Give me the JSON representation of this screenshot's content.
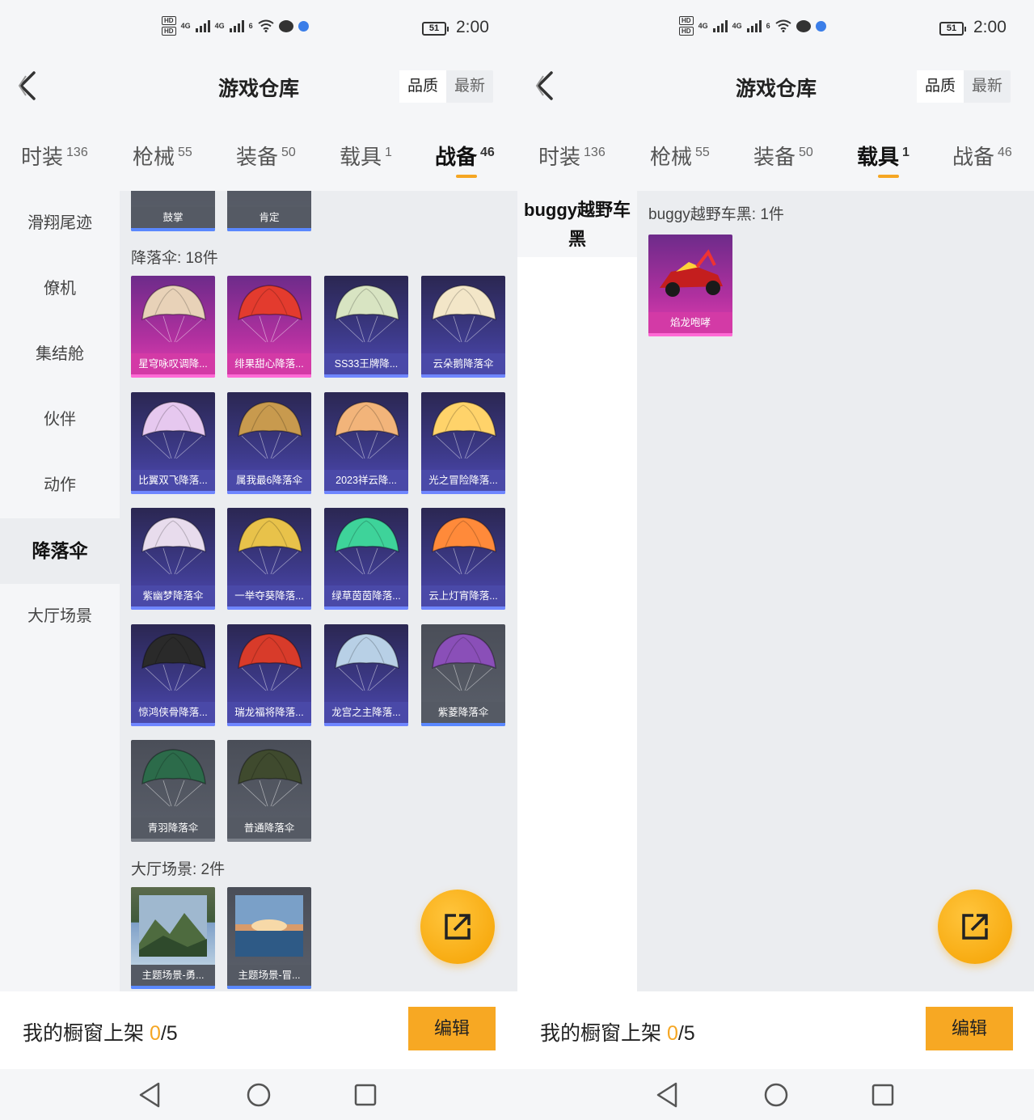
{
  "status": {
    "time": "2:00",
    "battery": "51",
    "hd1": "HD",
    "hd2": "HD",
    "net1": "4G",
    "net2": "4G",
    "wifi": "6"
  },
  "header": {
    "title": "游戏仓库",
    "sort_quality": "品质",
    "sort_latest": "最新"
  },
  "tabs": [
    {
      "label": "时装",
      "count": "136"
    },
    {
      "label": "枪械",
      "count": "55"
    },
    {
      "label": "装备",
      "count": "50"
    },
    {
      "label": "载具",
      "count": "1"
    },
    {
      "label": "战备",
      "count": "46"
    }
  ],
  "left": {
    "active_tab": "战备",
    "sidebar": [
      "滑翔尾迹",
      "僚机",
      "集结舱",
      "伙伴",
      "动作",
      "降落伞",
      "大厅场景"
    ],
    "sidebar_active": "降落伞",
    "top_partial_cards": [
      "鼓掌",
      "肯定"
    ],
    "parachute_section": "降落伞: 18件",
    "parachutes": [
      {
        "name": "星穹咏叹调降...",
        "quality": "pink"
      },
      {
        "name": "绯果甜心降落...",
        "quality": "pink"
      },
      {
        "name": "SS33王牌降...",
        "quality": "blue"
      },
      {
        "name": "云朵鹅降落伞",
        "quality": "blue"
      },
      {
        "name": "比翼双飞降落...",
        "quality": "blue"
      },
      {
        "name": "属我最6降落伞",
        "quality": "blue"
      },
      {
        "name": "2023祥云降...",
        "quality": "blue"
      },
      {
        "name": "光之冒险降落...",
        "quality": "blue"
      },
      {
        "name": "紫幽梦降落伞",
        "quality": "blue"
      },
      {
        "name": "一举夺葵降落...",
        "quality": "blue"
      },
      {
        "name": "绿草茵茵降落...",
        "quality": "blue"
      },
      {
        "name": "云上灯宵降落...",
        "quality": "blue"
      },
      {
        "name": "惊鸿侠骨降落...",
        "quality": "blue"
      },
      {
        "name": "瑞龙福将降落...",
        "quality": "blue"
      },
      {
        "name": "龙宫之主降落...",
        "quality": "blue"
      },
      {
        "name": "紫菱降落伞",
        "quality": "grey-blue"
      },
      {
        "name": "青羽降落伞",
        "quality": "grey"
      },
      {
        "name": "普通降落伞",
        "quality": "grey"
      }
    ],
    "lobby_section": "大厅场景: 2件",
    "lobby": [
      {
        "name": "主题场景-勇..."
      },
      {
        "name": "主题场景-冒..."
      }
    ]
  },
  "right": {
    "active_tab": "载具",
    "sidebar_title": "buggy越野车黑",
    "section": "buggy越野车黑: 1件",
    "items": [
      {
        "name": "焰龙咆哮",
        "quality": "pink"
      }
    ]
  },
  "bottom": {
    "label": "我的橱窗上架 ",
    "count": "0",
    "total": "/5",
    "edit": "编辑"
  },
  "colors": {
    "accent": "#f5a623",
    "pink": "#d33aa6",
    "blue": "#4a49a8"
  }
}
